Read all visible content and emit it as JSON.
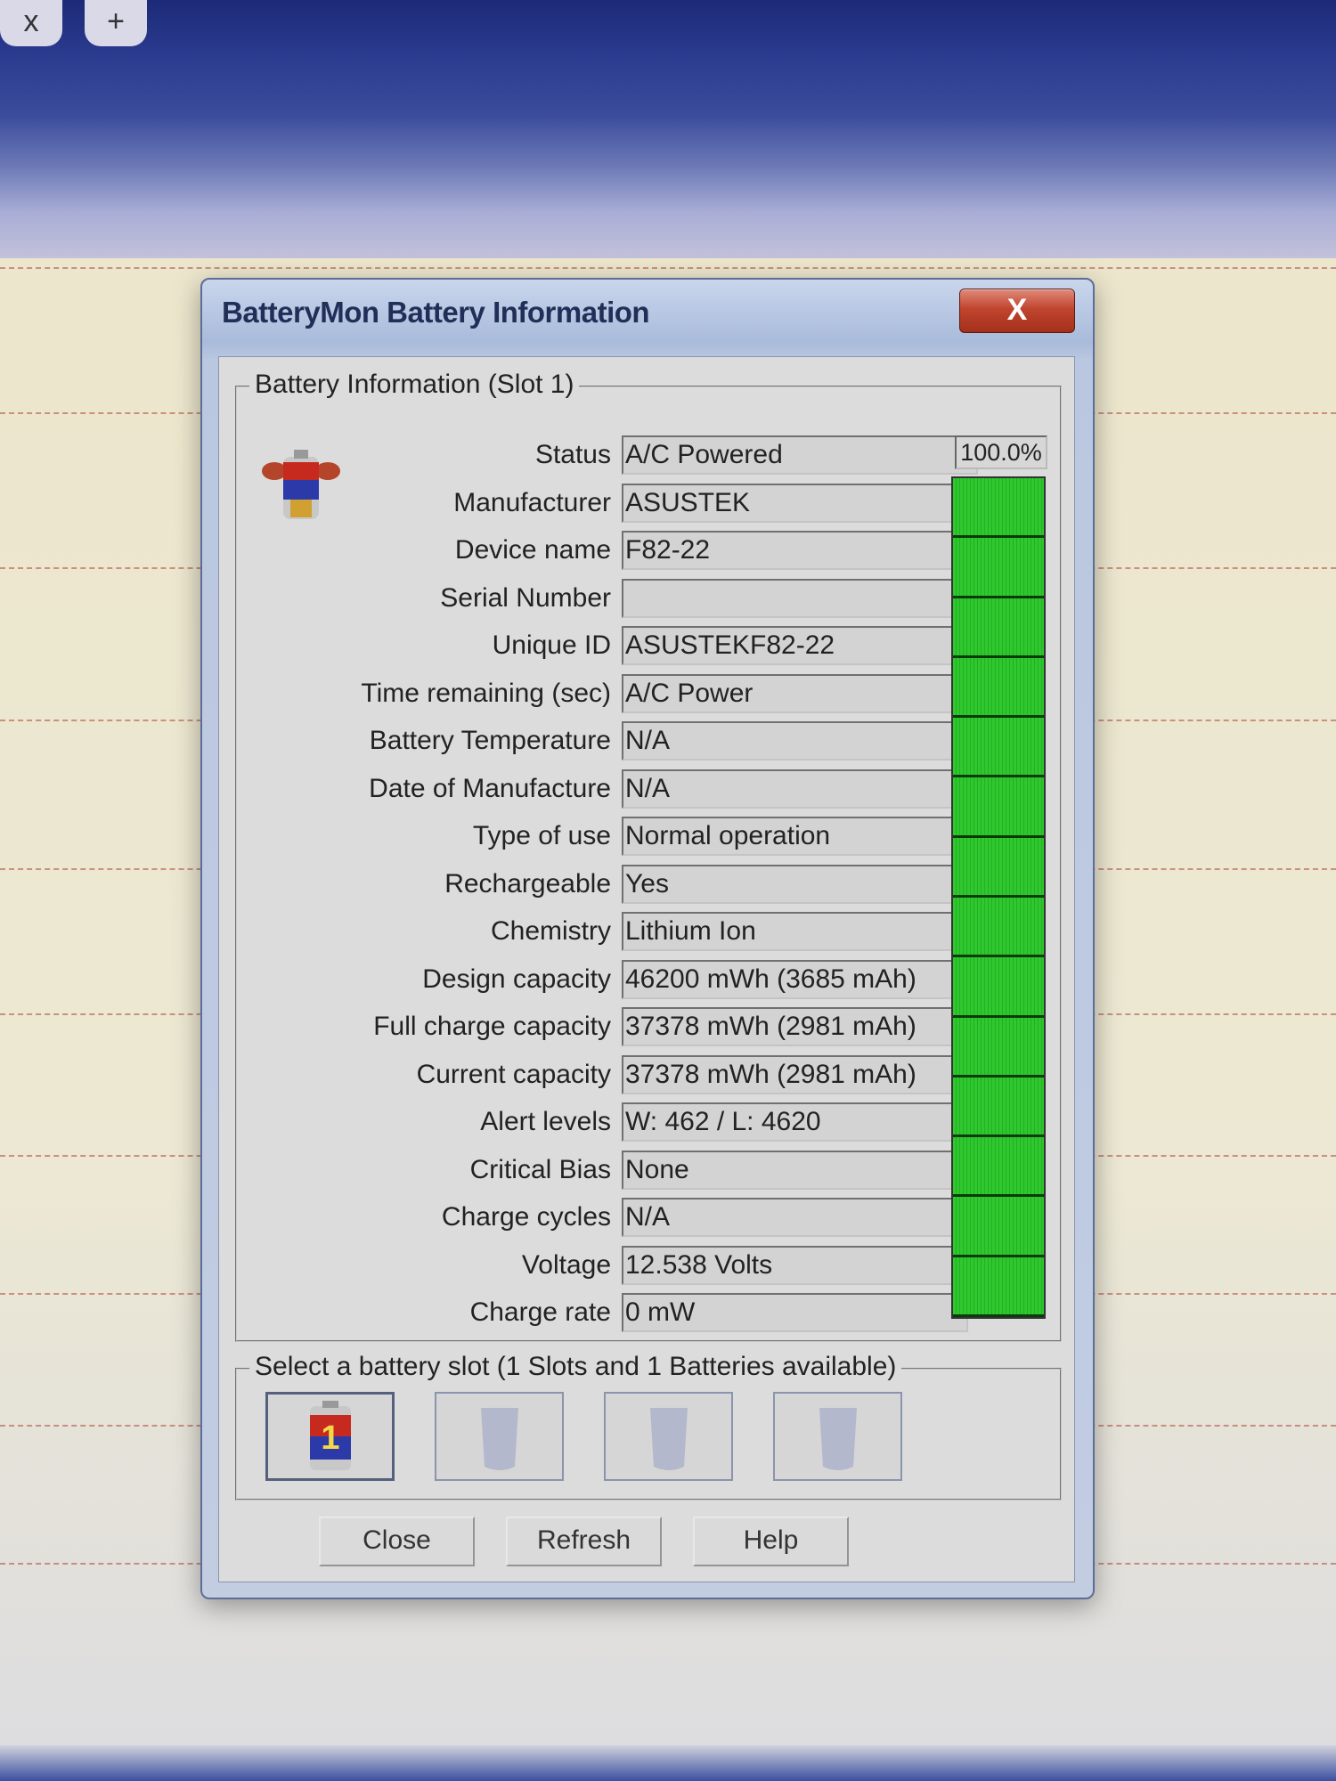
{
  "background": {
    "tabs": [
      "x",
      "+"
    ]
  },
  "dialog": {
    "title": "BatteryMon Battery Information",
    "close_glyph": "X",
    "group_title": "Battery Information (Slot 1)",
    "fields": [
      {
        "label": "Status",
        "value": "A/C Powered"
      },
      {
        "label": "Manufacturer",
        "value": "ASUSTEK"
      },
      {
        "label": "Device name",
        "value": "F82-22"
      },
      {
        "label": "Serial Number",
        "value": ""
      },
      {
        "label": "Unique ID",
        "value": "ASUSTEKF82-22"
      },
      {
        "label": "Time remaining (sec)",
        "value": "A/C Power"
      },
      {
        "label": "Battery Temperature",
        "value": "N/A"
      },
      {
        "label": "Date of Manufacture",
        "value": "N/A"
      },
      {
        "label": "Type of use",
        "value": "Normal operation"
      },
      {
        "label": "Rechargeable",
        "value": "Yes"
      },
      {
        "label": "Chemistry",
        "value": "Lithium Ion"
      },
      {
        "label": "Design capacity",
        "value": "46200 mWh (3685 mAh)"
      },
      {
        "label": "Full charge capacity",
        "value": "37378 mWh (2981 mAh)"
      },
      {
        "label": "Current capacity",
        "value": "37378 mWh (2981 mAh)"
      },
      {
        "label": "Alert levels",
        "value": "W: 462 / L: 4620"
      },
      {
        "label": "Critical Bias",
        "value": "None"
      },
      {
        "label": "Charge cycles",
        "value": "N/A"
      },
      {
        "label": "Voltage",
        "value": "12.538 Volts"
      },
      {
        "label": "Charge rate",
        "value": "0 mW"
      }
    ],
    "charge_percent_text": "100.0%",
    "charge_level": 1.0,
    "meter_color": "#2fc82f",
    "slot_group_title": "Select a battery slot (1 Slots and 1 Batteries available)",
    "slots": [
      {
        "number": "1",
        "active": true
      },
      {
        "number": "",
        "active": false
      },
      {
        "number": "",
        "active": false
      },
      {
        "number": "",
        "active": false
      }
    ],
    "buttons": {
      "close": "Close",
      "refresh": "Refresh",
      "help": "Help"
    }
  }
}
